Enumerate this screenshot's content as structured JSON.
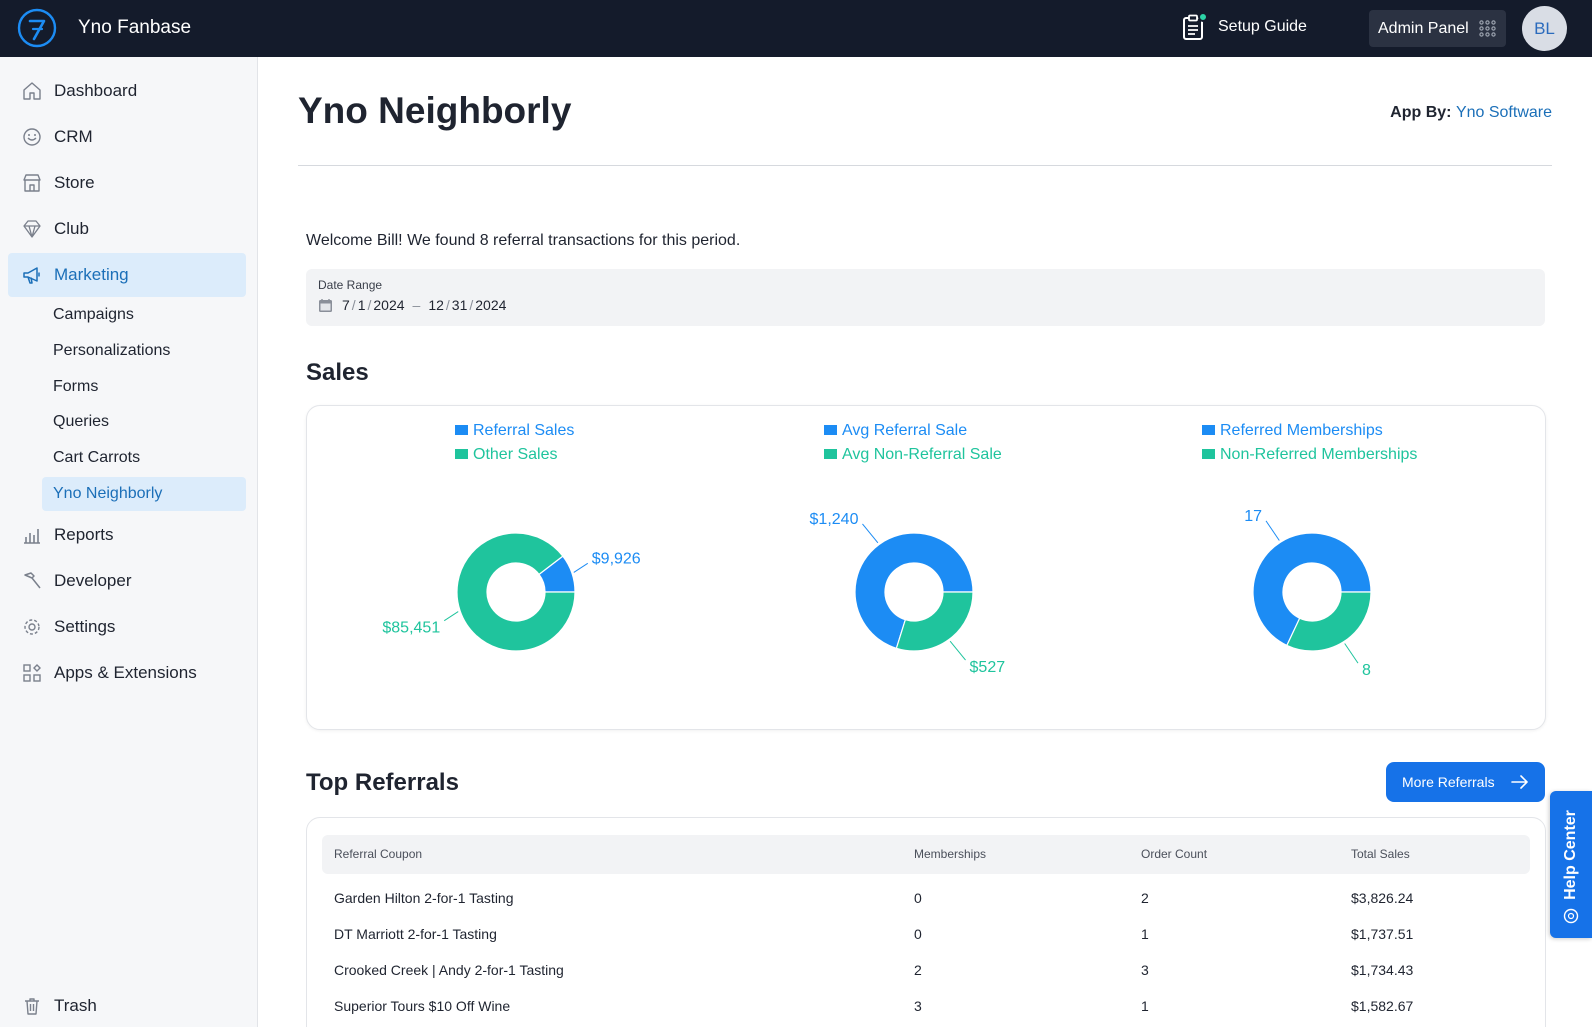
{
  "topbar": {
    "brand": "Yno Fanbase",
    "setup_guide": "Setup Guide",
    "admin_panel": "Admin Panel",
    "avatar_initials": "BL"
  },
  "sidebar": {
    "items": [
      {
        "label": "Dashboard",
        "icon": "home-icon"
      },
      {
        "label": "CRM",
        "icon": "smile-icon"
      },
      {
        "label": "Store",
        "icon": "store-icon"
      },
      {
        "label": "Club",
        "icon": "diamond-icon"
      },
      {
        "label": "Marketing",
        "icon": "megaphone-icon"
      },
      {
        "label": "Reports",
        "icon": "bar-chart-icon"
      },
      {
        "label": "Developer",
        "icon": "hammer-icon"
      },
      {
        "label": "Settings",
        "icon": "gear-icon"
      },
      {
        "label": "Apps & Extensions",
        "icon": "apps-icon"
      }
    ],
    "marketing_sub": [
      "Campaigns",
      "Personalizations",
      "Forms",
      "Queries",
      "Cart Carrots",
      "Yno Neighborly"
    ],
    "trash": "Trash"
  },
  "page": {
    "title": "Yno Neighborly",
    "app_by_label": "App By:",
    "app_by_vendor": "Yno Software",
    "welcome": "Welcome Bill! We found 8 referral transactions for this period."
  },
  "date_range": {
    "label": "Date Range",
    "start_month": "7",
    "start_day": "1",
    "start_year": "2024",
    "end_month": "12",
    "end_day": "31",
    "end_year": "2024"
  },
  "sales": {
    "title": "Sales"
  },
  "colors": {
    "blue": "#1c8cf4",
    "teal": "#1fc49d",
    "accent": "#1672e8"
  },
  "chart_data": [
    {
      "type": "pie",
      "series": [
        {
          "name": "Referral Sales",
          "value": 9926,
          "label": "$9,926"
        },
        {
          "name": "Other Sales",
          "value": 85451,
          "label": "$85,451"
        }
      ]
    },
    {
      "type": "pie",
      "series": [
        {
          "name": "Avg Referral Sale",
          "value": 1240,
          "label": "$1,240"
        },
        {
          "name": "Avg Non-Referral Sale",
          "value": 527,
          "label": "$527"
        }
      ]
    },
    {
      "type": "pie",
      "series": [
        {
          "name": "Referred Memberships",
          "value": 17,
          "label": "17"
        },
        {
          "name": "Non-Referred Memberships",
          "value": 8,
          "label": "8"
        }
      ]
    }
  ],
  "top_referrals": {
    "title": "Top Referrals",
    "more_button": "More Referrals",
    "columns": [
      "Referral Coupon",
      "Memberships",
      "Order Count",
      "Total Sales"
    ],
    "rows": [
      [
        "Garden Hilton 2-for-1 Tasting",
        "0",
        "2",
        "$3,826.24"
      ],
      [
        "DT Marriott 2-for-1 Tasting",
        "0",
        "1",
        "$1,737.51"
      ],
      [
        "Crooked Creek | Andy 2-for-1 Tasting",
        "2",
        "3",
        "$1,734.43"
      ],
      [
        "Superior Tours $10 Off Wine",
        "3",
        "1",
        "$1,582.67"
      ]
    ]
  },
  "help_center": "Help Center"
}
